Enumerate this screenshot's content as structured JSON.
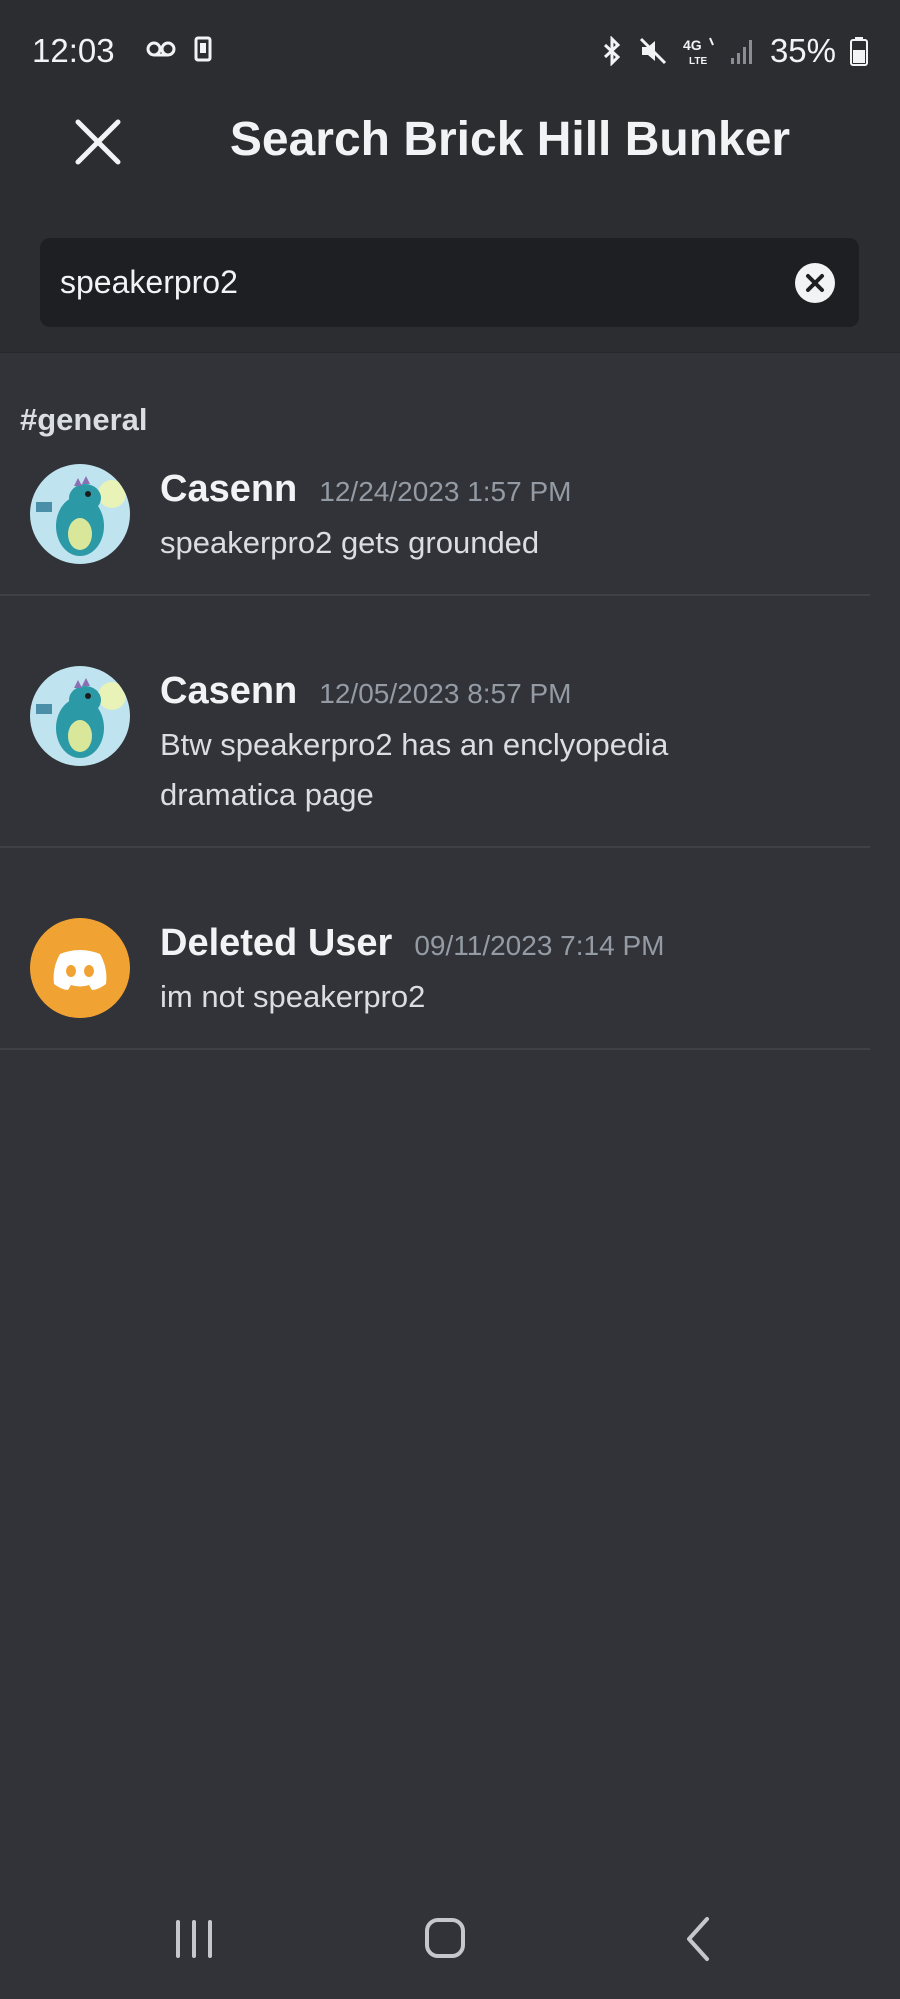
{
  "status": {
    "time": "12:03",
    "left_icons": [
      "voicemail-icon",
      "phone-vibrate-icon"
    ],
    "right_icons": [
      "bluetooth-icon",
      "mute-icon",
      "4g-lte-icon",
      "signal-icon"
    ],
    "battery": "35%"
  },
  "header": {
    "title": "Search Brick Hill Bunker",
    "close_icon": "close-icon"
  },
  "search": {
    "value": "speakerpro2",
    "clear_icon": "clear-circle-icon"
  },
  "results": {
    "channel": "#general",
    "items": [
      {
        "author": "Casenn",
        "timestamp": "12/24/2023 1:57 PM",
        "text": "speakerpro2 gets grounded",
        "avatar": "dinosaur-avatar"
      },
      {
        "author": "Casenn",
        "timestamp": "12/05/2023 8:57 PM",
        "text": "Btw speakerpro2 has an enclyopedia dramatica page",
        "avatar": "dinosaur-avatar"
      },
      {
        "author": "Deleted User",
        "timestamp": "09/11/2023 7:14 PM",
        "text": "im not speakerpro2",
        "avatar": "discord-logo-avatar",
        "avatar_color": "#f0a232"
      }
    ]
  },
  "nav": {
    "items": [
      "recent-apps-icon",
      "home-icon",
      "back-icon"
    ]
  },
  "colors": {
    "background": "#313338",
    "topbar": "#2b2d31",
    "search_field": "#1e1f22",
    "timestamp": "#949ba4",
    "deleted_avatar": "#f0a232"
  }
}
